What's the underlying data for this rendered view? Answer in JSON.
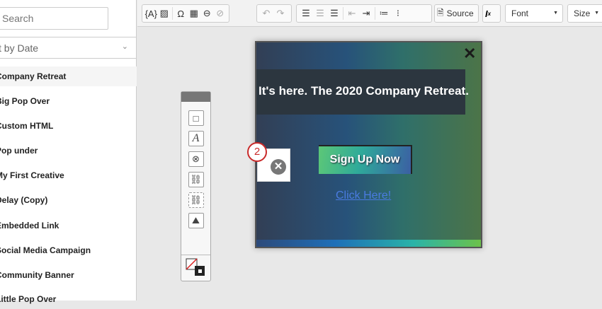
{
  "sidebar": {
    "search_placeholder": "Search",
    "sort_label": "t by Date",
    "items": [
      {
        "label": "Company Retreat"
      },
      {
        "label": "Big Pop Over"
      },
      {
        "label": "Custom HTML"
      },
      {
        "label": "Pop under"
      },
      {
        "label": "My First Creative"
      },
      {
        "label": "Delay (Copy)"
      },
      {
        "label": "Embedded Link"
      },
      {
        "label": "Social Media Campaign"
      },
      {
        "label": "Community Banner"
      },
      {
        "label": "Little Pop Over"
      }
    ]
  },
  "toolbar": {
    "source_label": "Source",
    "font_label": "Font",
    "size_label": "Size"
  },
  "popup": {
    "headline": "It's here. The 2020 Company Retreat.",
    "button_label": "Sign Up Now",
    "link_label": "Click Here!",
    "close_glyph": "✕"
  },
  "selection": {
    "badge": "2"
  }
}
